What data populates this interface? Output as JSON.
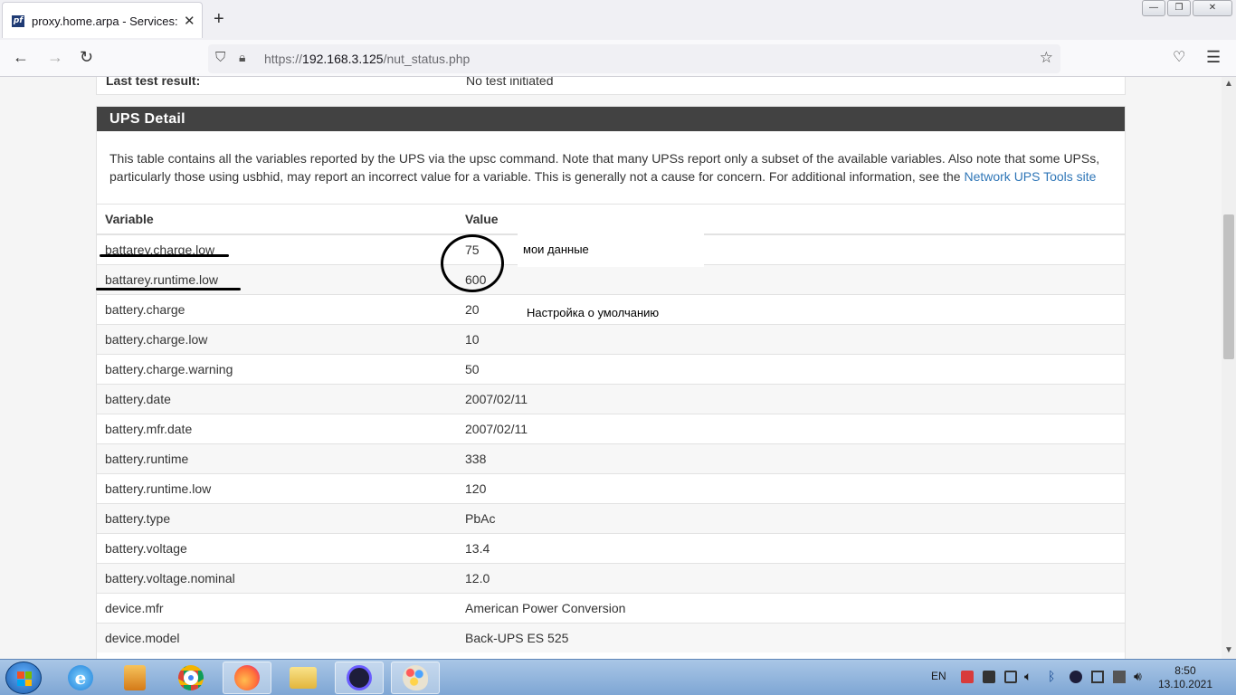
{
  "browser": {
    "tab_title": "proxy.home.arpa - Services: UPS",
    "favicon_text": "pf",
    "url_prefix": "https://",
    "url_host": "192.168.3.125",
    "url_path": "/nut_status.php"
  },
  "prev_panel": {
    "label": "Last test result:",
    "value": "No test initiated"
  },
  "panel": {
    "title": "UPS Detail",
    "description": "This table contains all the variables reported by the UPS via the upsc command. Note that many UPSs report only a subset of the available variables. Also note that some UPSs, particularly those using usbhid, may report an incorrect value for a variable. This is generally not a cause for concern. For additional information, see the ",
    "link_text": "Network UPS Tools site"
  },
  "table": {
    "col_variable": "Variable",
    "col_value": "Value",
    "rows": [
      {
        "variable": "battarey.charge.low",
        "value": "75"
      },
      {
        "variable": "battarey.runtime.low",
        "value": "600"
      },
      {
        "variable": "battery.charge",
        "value": "20"
      },
      {
        "variable": "battery.charge.low",
        "value": "10"
      },
      {
        "variable": "battery.charge.warning",
        "value": "50"
      },
      {
        "variable": "battery.date",
        "value": "2007/02/11"
      },
      {
        "variable": "battery.mfr.date",
        "value": "2007/02/11"
      },
      {
        "variable": "battery.runtime",
        "value": "338"
      },
      {
        "variable": "battery.runtime.low",
        "value": "120"
      },
      {
        "variable": "battery.type",
        "value": "PbAc"
      },
      {
        "variable": "battery.voltage",
        "value": "13.4"
      },
      {
        "variable": "battery.voltage.nominal",
        "value": "12.0"
      },
      {
        "variable": "device.mfr",
        "value": "American Power Conversion"
      },
      {
        "variable": "device.model",
        "value": "Back-UPS ES 525"
      }
    ]
  },
  "annotations": {
    "my_data": "мои данные",
    "default_setting": "Настройка о умолчанию"
  },
  "taskbar": {
    "lang": "EN",
    "time": "8:50",
    "date": "13.10.2021"
  }
}
